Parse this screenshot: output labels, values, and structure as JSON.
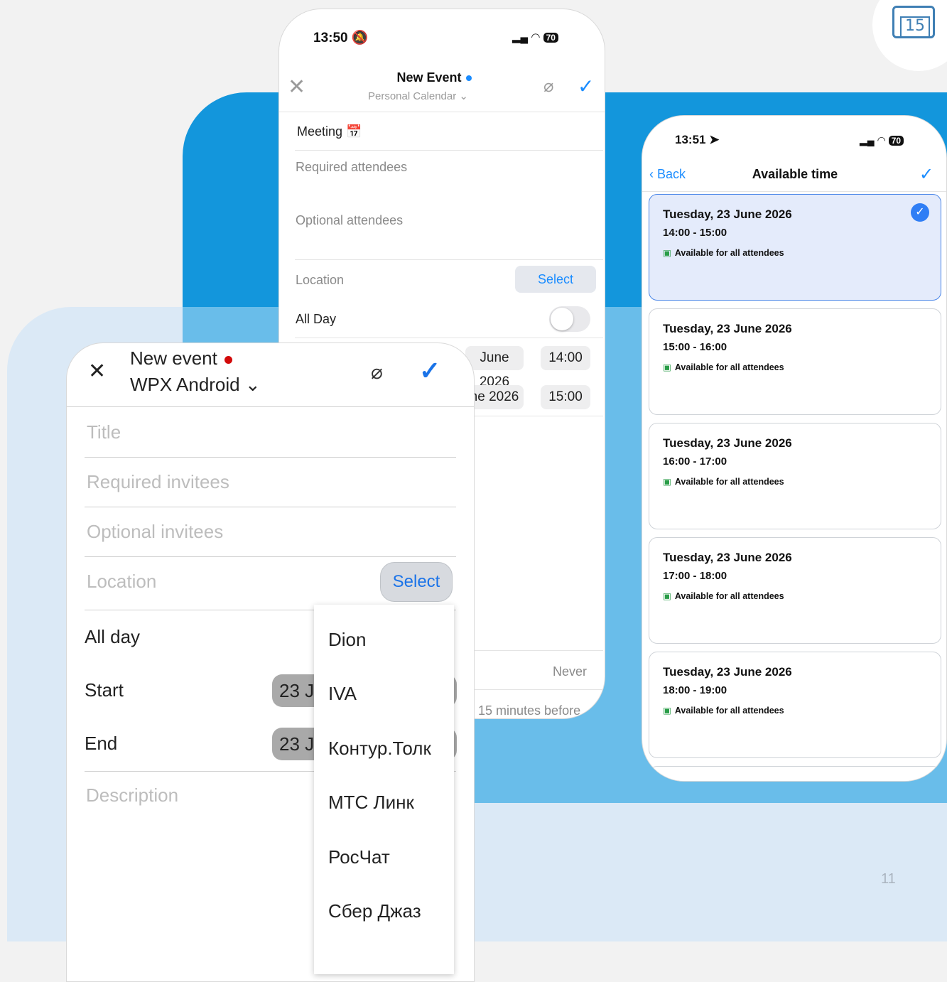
{
  "page": {
    "number": "11"
  },
  "corner_icon": {
    "day": "15"
  },
  "ios_new_event": {
    "time": "13:50",
    "battery": "70",
    "title": "New Event",
    "calendar": "Personal Calendar",
    "subject": "Meeting",
    "subject_emoji": "📅",
    "required_attendees": "Required attendees",
    "optional_attendees": "Optional attendees",
    "location_label": "Location",
    "select_label": "Select",
    "all_day_label": "All Day",
    "start_date_partial": "June 2026",
    "start_time": "14:00",
    "end_date_partial": "ne 2026",
    "end_time": "15:00",
    "repeat_value": "Never",
    "alert_value": "15 minutes before"
  },
  "available_time": {
    "time": "13:51",
    "battery": "70",
    "back_label": "Back",
    "title": "Available time",
    "slots": [
      {
        "date": "Tuesday, 23 June 2026",
        "range": "14:00 - 15:00",
        "status": "Available for all attendees",
        "selected": true
      },
      {
        "date": "Tuesday, 23 June 2026",
        "range": "15:00 - 16:00",
        "status": "Available for all attendees",
        "selected": false
      },
      {
        "date": "Tuesday, 23 June 2026",
        "range": "16:00 - 17:00",
        "status": "Available for all attendees",
        "selected": false
      },
      {
        "date": "Tuesday, 23 June 2026",
        "range": "17:00 - 18:00",
        "status": "Available for all attendees",
        "selected": false
      },
      {
        "date": "Tuesday, 23 June 2026",
        "range": "18:00 - 19:00",
        "status": "Available for all attendees",
        "selected": false
      }
    ]
  },
  "android_new_event": {
    "title": "New event",
    "calendar": "WPX Android",
    "title_hint": "Title",
    "required_hint": "Required invitees",
    "optional_hint": "Optional invitees",
    "location_hint": "Location",
    "select_label": "Select",
    "all_day_label": "All day",
    "start_label": "Start",
    "start_date_partial": "23 J",
    "end_label": "End",
    "end_date_partial": "23 J",
    "description_hint": "Description",
    "location_options": [
      "Dion",
      "IVA",
      "Контур.Толк",
      "МТС Линк",
      "РосЧат",
      "Сбер Джаз"
    ]
  }
}
